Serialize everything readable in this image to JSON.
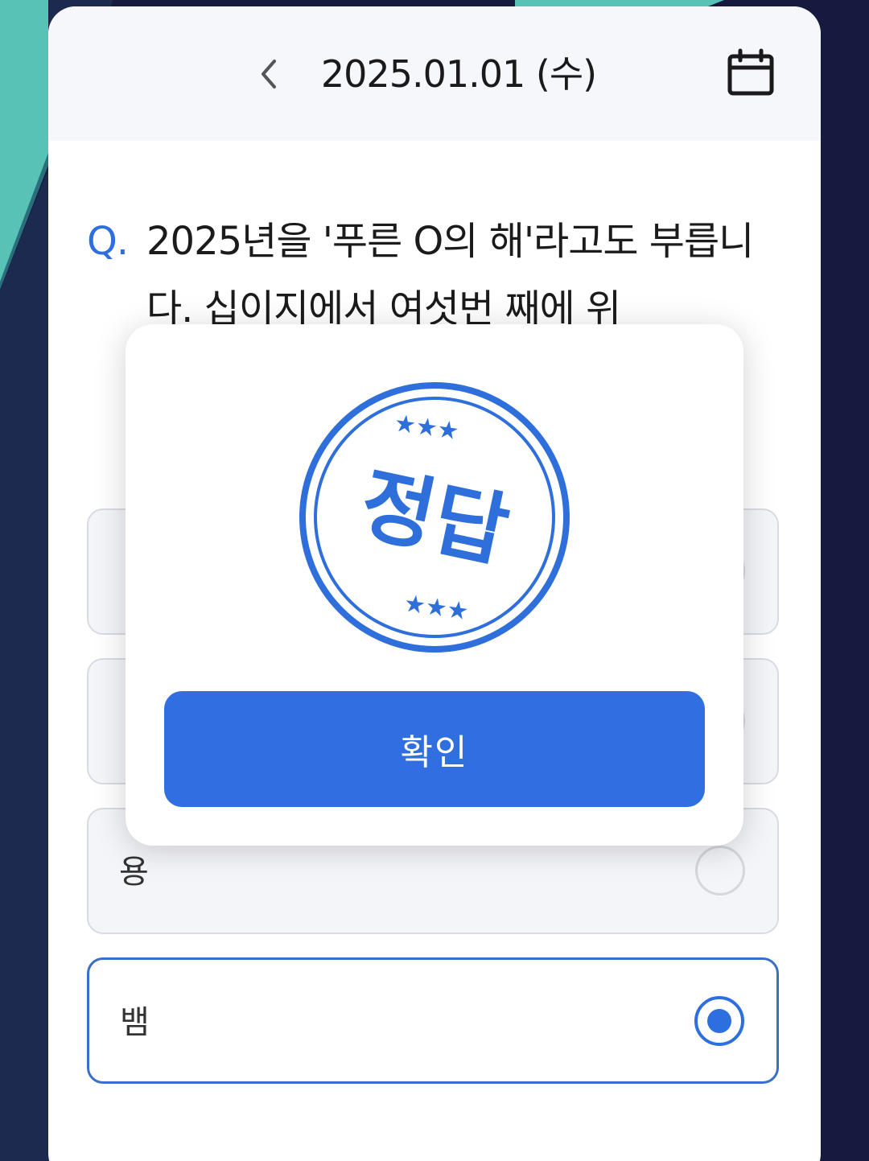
{
  "header": {
    "date": "2025.01.01 (수)",
    "back_icon": "chevron-left-icon",
    "calendar_icon": "calendar-icon"
  },
  "question": {
    "marker": "Q.",
    "text": "2025년을 '푸른 O의 해'라고도 부릅니다. 십이지에서 여섯번 째에 위"
  },
  "options": [
    {
      "label": "",
      "selected": false
    },
    {
      "label": "",
      "selected": false
    },
    {
      "label": "용",
      "selected": false
    },
    {
      "label": "뱀",
      "selected": true
    }
  ],
  "modal": {
    "stamp_text": "정답",
    "confirm_label": "확인"
  },
  "colors": {
    "accent": "#316fe0",
    "stamp": "#2f6fdc",
    "background_dark": "#161a3f",
    "background_teal": "#5cc3b8"
  }
}
